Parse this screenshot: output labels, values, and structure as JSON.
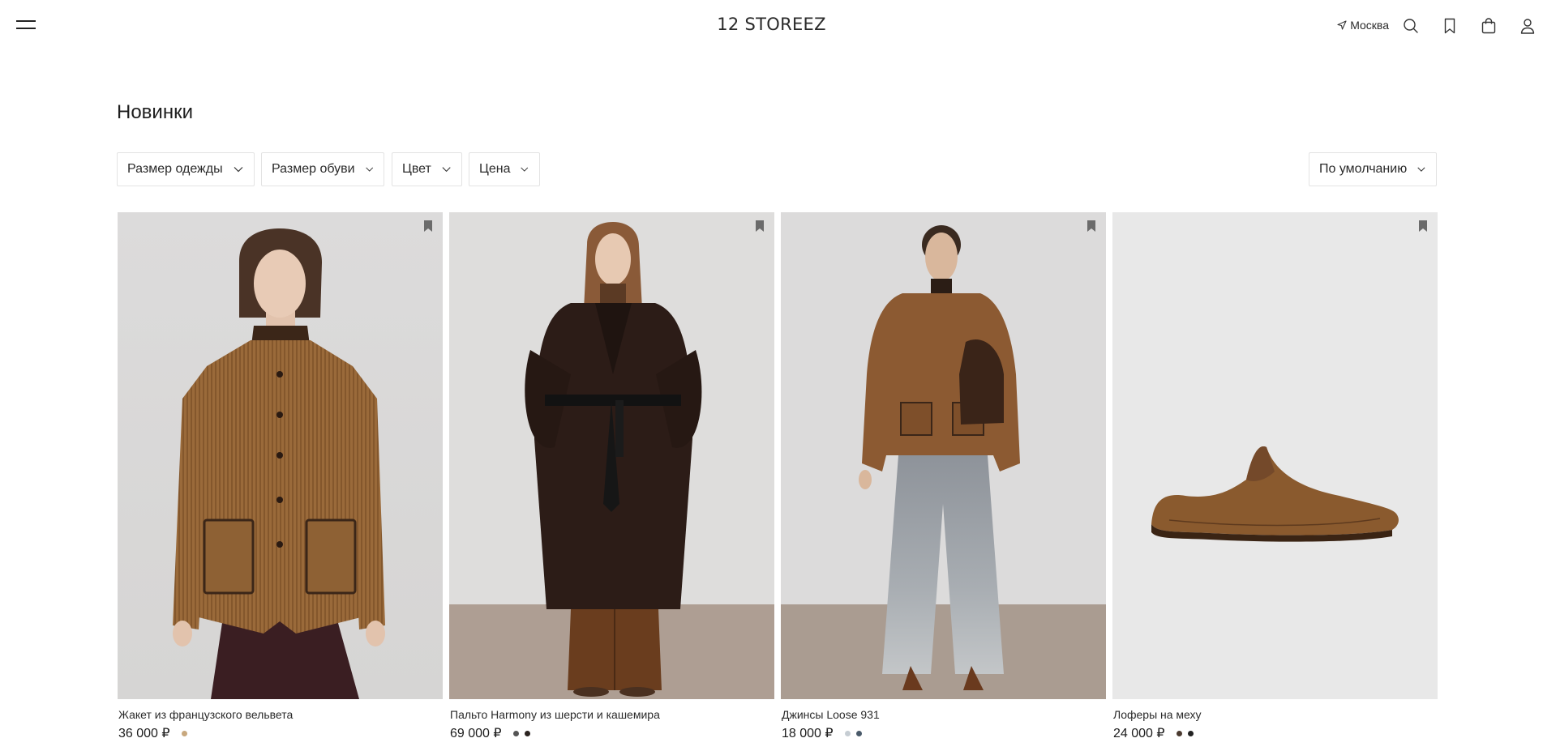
{
  "header": {
    "logo": "12 STOREEZ",
    "city": "Москва",
    "icons": [
      "menu-icon",
      "location-arrow-icon",
      "search-icon",
      "bookmark-icon",
      "bag-icon",
      "user-icon"
    ]
  },
  "page": {
    "title": "Новинки"
  },
  "filters": {
    "clothing_size": "Размер одежды",
    "shoe_size": "Размер обуви",
    "color": "Цвет",
    "price": "Цена",
    "sort": "По умолчанию"
  },
  "products": [
    {
      "name": "Жакет из французского вельвета",
      "price": "36 000 ₽",
      "swatches": [
        "#c8a87e"
      ]
    },
    {
      "name": "Пальто Harmony из шерсти и кашемира",
      "price": "69 000 ₽",
      "swatches": [
        "#555555",
        "#2b2320"
      ]
    },
    {
      "name": "Джинсы Loose 931",
      "price": "18 000 ₽",
      "swatches": [
        "#c6cdd3",
        "#4a5a6a"
      ]
    },
    {
      "name": "Лоферы на меху",
      "price": "24 000 ₽",
      "swatches": [
        "#4a3a30",
        "#222222"
      ]
    }
  ]
}
